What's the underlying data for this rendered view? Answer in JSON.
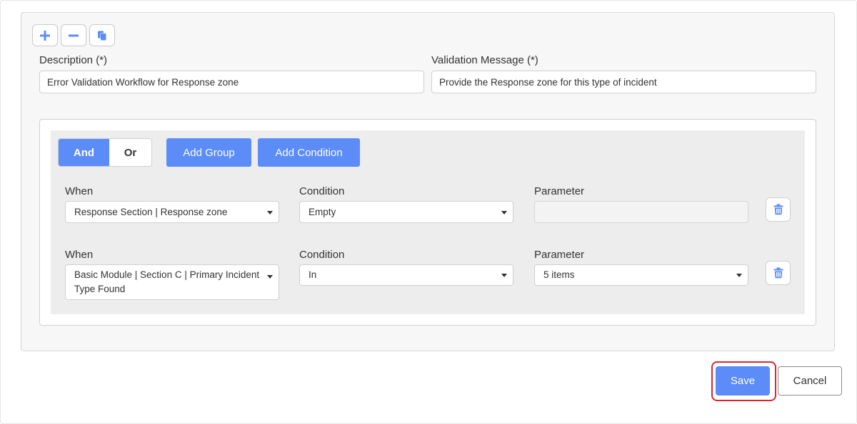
{
  "toolbar": {
    "icons": [
      "plus-icon",
      "minus-icon",
      "copy-icon"
    ],
    "accent_color": "#5b8cf7"
  },
  "form": {
    "description": {
      "label": "Description (*)",
      "value": "Error Validation Workflow for Response zone"
    },
    "validation_message": {
      "label": "Validation Message (*)",
      "value": "Provide the Response zone for this type of incident"
    }
  },
  "group": {
    "operators": {
      "and": "And",
      "or": "Or",
      "selected": "And"
    },
    "add_group_label": "Add Group",
    "add_condition_label": "Add Condition",
    "conditions": [
      {
        "when_label": "When",
        "when_value": "Response Section | Response zone",
        "condition_label": "Condition",
        "condition_value": "Empty",
        "parameter_label": "Parameter",
        "parameter_value": ""
      },
      {
        "when_label": "When",
        "when_value": "Basic Module | Section C | Primary Incident Type Found",
        "condition_label": "Condition",
        "condition_value": "In",
        "parameter_label": "Parameter",
        "parameter_value": "5 items"
      }
    ]
  },
  "footer": {
    "save_label": "Save",
    "cancel_label": "Cancel",
    "highlight_color": "#e0242f"
  }
}
